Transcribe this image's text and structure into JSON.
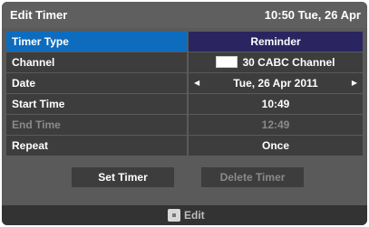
{
  "header": {
    "title": "Edit Timer",
    "clock": "10:50 Tue, 26 Apr"
  },
  "rows": [
    {
      "label": "Timer Type",
      "value": "Reminder",
      "state": "selected"
    },
    {
      "label": "Channel",
      "value": "30 CABC Channel",
      "state": "normal"
    },
    {
      "label": "Date",
      "value": "Tue, 26 Apr 2011",
      "state": "normal"
    },
    {
      "label": "Start Time",
      "value": "10:49",
      "state": "normal"
    },
    {
      "label": "End Time",
      "value": "12:49",
      "state": "disabled"
    },
    {
      "label": "Repeat",
      "value": "Once",
      "state": "normal"
    }
  ],
  "buttons": {
    "set": "Set Timer",
    "delete": "Delete Timer"
  },
  "footer": {
    "hint": "Edit",
    "icon": "dpad-icon"
  },
  "colors": {
    "selected_label": "#0d6cbd",
    "selected_value": "#2a2560",
    "row_bg": "#3d3d3d"
  }
}
